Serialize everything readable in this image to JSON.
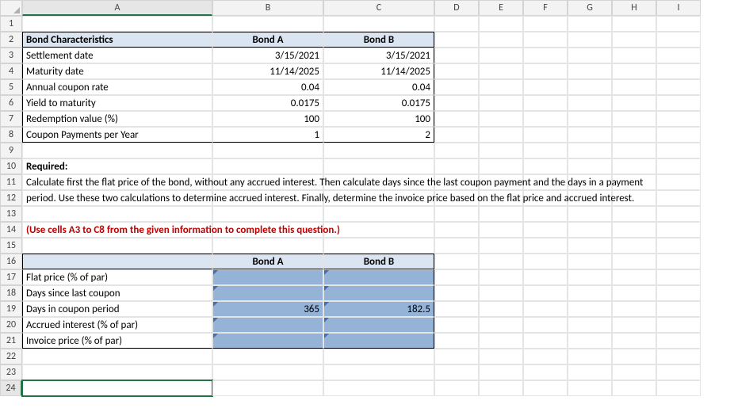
{
  "columns": [
    "A",
    "B",
    "C",
    "D",
    "E",
    "F",
    "G",
    "H",
    "I"
  ],
  "rows": [
    "1",
    "2",
    "3",
    "4",
    "5",
    "6",
    "7",
    "8",
    "9",
    "10",
    "11",
    "12",
    "13",
    "14",
    "15",
    "16",
    "17",
    "18",
    "19",
    "20",
    "21",
    "22",
    "23",
    "24"
  ],
  "table1": {
    "header": {
      "a": "Bond Characteristics",
      "b": "Bond A",
      "c": "Bond B"
    },
    "rows": [
      {
        "label": "Settlement date",
        "b": "3/15/2021",
        "c": "3/15/2021"
      },
      {
        "label": "Maturity date",
        "b": "11/14/2025",
        "c": "11/14/2025"
      },
      {
        "label": "Annual coupon rate",
        "b": "0.04",
        "c": "0.04"
      },
      {
        "label": "Yield to maturity",
        "b": "0.0175",
        "c": "0.0175"
      },
      {
        "label": "Redemption value (%)",
        "b": "100",
        "c": "100"
      },
      {
        "label": "Coupon Payments per Year",
        "b": "1",
        "c": "2"
      }
    ]
  },
  "required_label": "Required:",
  "required_text": "Calculate first the flat price of the bond, without any accrued interest. Then calculate days since the last coupon payment and the days in a payment period. Use these two calculations to determine accrued interest. Finally, determine the invoice price based on the flat price and accrued interest.",
  "hint": "(Use cells A3 to C8 from the given information to complete this question.)",
  "table2": {
    "header": {
      "b": "Bond A",
      "c": "Bond B"
    },
    "rows": [
      {
        "label": "Flat price (% of par)",
        "b": "",
        "c": ""
      },
      {
        "label": "Days since last coupon",
        "b": "",
        "c": ""
      },
      {
        "label": "Days in coupon period",
        "b": "365",
        "c": "182.5"
      },
      {
        "label": "Accrued interest (% of par)",
        "b": "",
        "c": ""
      },
      {
        "label": "Invoice price (% of par)",
        "b": "",
        "c": ""
      }
    ]
  },
  "chart_data": {
    "type": "table",
    "title": "Bond Characteristics and Invoice Price Calculation",
    "input_table": {
      "columns": [
        "Bond A",
        "Bond B"
      ],
      "rows": {
        "Settlement date": [
          "3/15/2021",
          "3/15/2021"
        ],
        "Maturity date": [
          "11/14/2025",
          "11/14/2025"
        ],
        "Annual coupon rate": [
          0.04,
          0.04
        ],
        "Yield to maturity": [
          0.0175,
          0.0175
        ],
        "Redemption value (%)": [
          100,
          100
        ],
        "Coupon Payments per Year": [
          1,
          2
        ]
      }
    },
    "answer_table": {
      "columns": [
        "Bond A",
        "Bond B"
      ],
      "rows": {
        "Flat price (% of par)": [
          null,
          null
        ],
        "Days since last coupon": [
          null,
          null
        ],
        "Days in coupon period": [
          365,
          182.5
        ],
        "Accrued interest (% of par)": [
          null,
          null
        ],
        "Invoice price (% of par)": [
          null,
          null
        ]
      }
    }
  }
}
